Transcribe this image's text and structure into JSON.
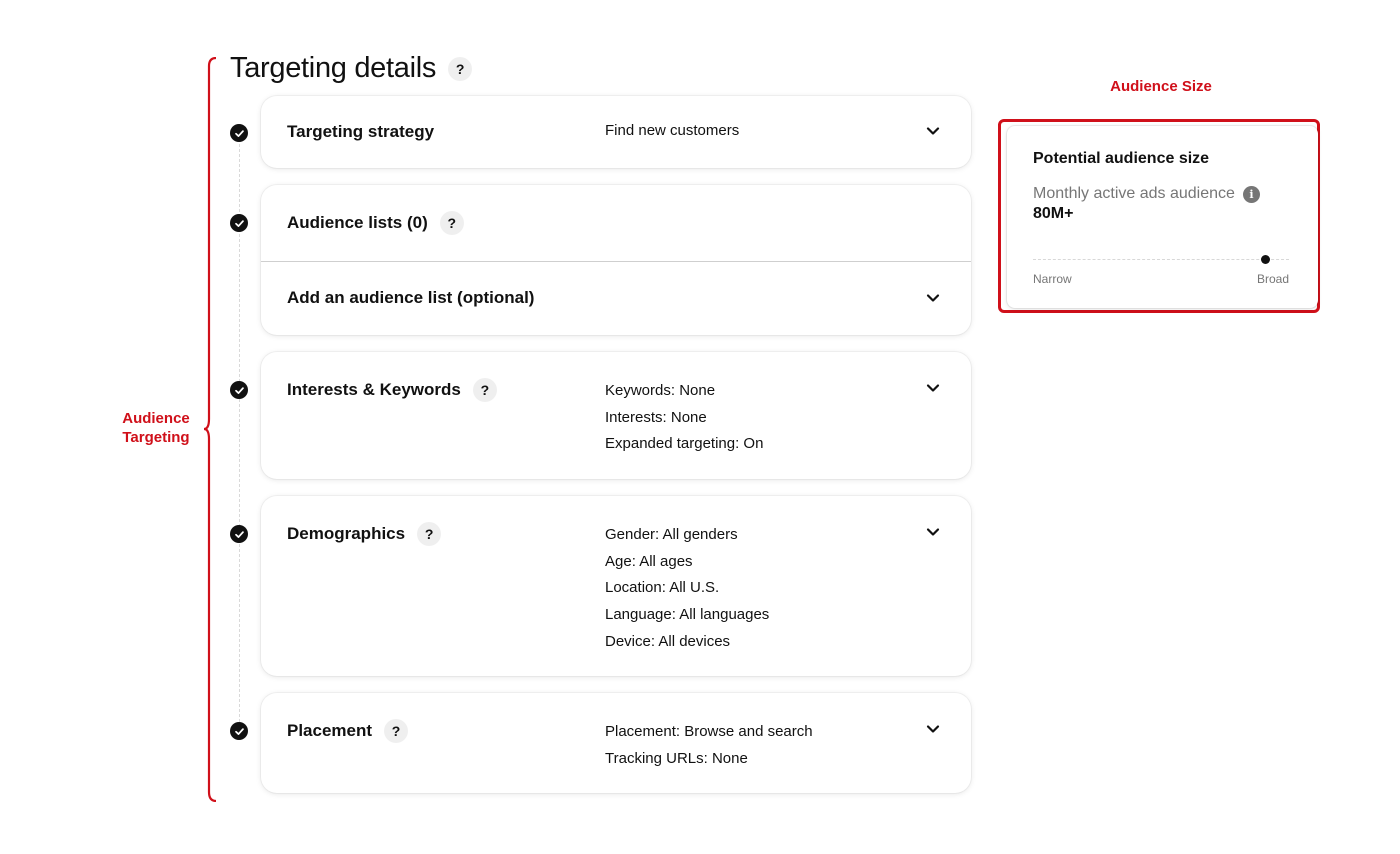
{
  "page": {
    "title": "Targeting details",
    "title_help": "?"
  },
  "annotations": {
    "audience_targeting_line1": "Audience",
    "audience_targeting_line2": "Targeting",
    "audience_size": "Audience Size",
    "color": "#d0101a"
  },
  "sections": {
    "targeting_strategy": {
      "label": "Targeting strategy",
      "value": "Find new customers"
    },
    "audience_lists": {
      "label": "Audience lists (0)",
      "help": "?",
      "add_label": "Add an audience list (optional)"
    },
    "interests_keywords": {
      "label": "Interests & Keywords",
      "help": "?",
      "values": [
        "Keywords: None",
        "Interests: None",
        "Expanded targeting: On"
      ]
    },
    "demographics": {
      "label": "Demographics",
      "help": "?",
      "values": [
        "Gender: All genders",
        "Age: All ages",
        "Location: All U.S.",
        "Language: All languages",
        "Device: All devices"
      ]
    },
    "placement": {
      "label": "Placement",
      "help": "?",
      "values": [
        "Placement: Browse and search",
        "Tracking URLs: None"
      ]
    }
  },
  "audience_size": {
    "title": "Potential audience size",
    "subtitle": "Monthly active ads audience",
    "info_icon": "i",
    "value": "80M+",
    "meter_min_label": "Narrow",
    "meter_max_label": "Broad",
    "meter_level": 0.91
  },
  "icons": {
    "check": "check-circle-icon",
    "chevron": "chevron-down-icon",
    "help": "help-circle-icon",
    "info": "info-icon"
  }
}
